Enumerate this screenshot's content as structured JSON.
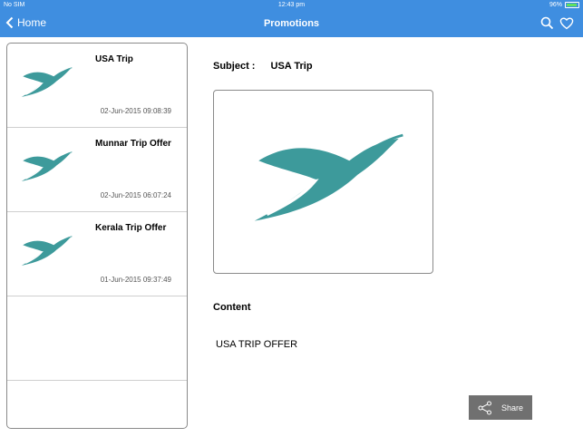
{
  "status_bar": {
    "carrier": "No SIM",
    "time": "12:43 pm",
    "battery": "96%"
  },
  "navbar": {
    "back_label": "Home",
    "title": "Promotions",
    "icons": [
      "chevron-left-icon",
      "search-icon",
      "heart-icon"
    ]
  },
  "promotions": [
    {
      "title": "USA Trip",
      "date": "02-Jun-2015 09:08:39"
    },
    {
      "title": "Munnar Trip Offer",
      "date": "02-Jun-2015 06:07:24"
    },
    {
      "title": "Kerala Trip Offer",
      "date": "01-Jun-2015 09:37:49"
    }
  ],
  "detail": {
    "subject_label": "Subject :",
    "subject_value": "USA Trip",
    "content_heading": "Content",
    "content_text": "USA TRIP OFFER"
  },
  "share": {
    "label": "Share",
    "icon": "share-icon"
  },
  "colors": {
    "nav": "#3f8ee0",
    "logo": "#3d9a9b",
    "share_bg": "#707070"
  }
}
